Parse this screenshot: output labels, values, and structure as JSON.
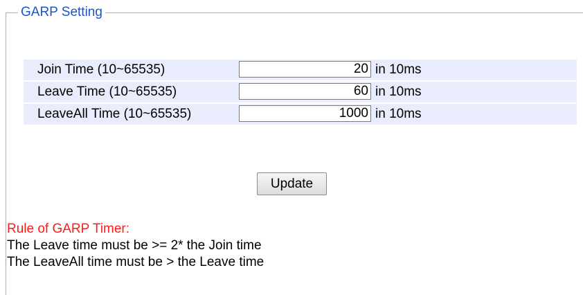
{
  "section": {
    "legend": "GARP Setting"
  },
  "rows": [
    {
      "label": "Join Time (10~65535)",
      "value": "20",
      "unit": "in 10ms"
    },
    {
      "label": "Leave Time (10~65535)",
      "value": "60",
      "unit": "in 10ms"
    },
    {
      "label": "LeaveAll Time (10~65535)",
      "value": "1000",
      "unit": "in 10ms"
    }
  ],
  "actions": {
    "update_label": "Update"
  },
  "rules": {
    "title": "Rule of GARP Timer:",
    "lines": [
      "The Leave time must be >= 2* the Join time",
      "The LeaveAll time must be > the Leave time"
    ]
  },
  "colors": {
    "legend": "#1a55c8",
    "row_bg": "#e9ecfc",
    "rule_title": "#ff1a1a"
  }
}
